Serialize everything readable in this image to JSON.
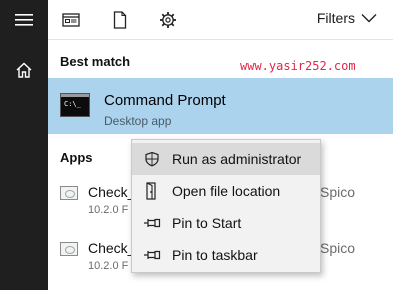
{
  "toolbar": {
    "filters_label": "Filters"
  },
  "best_match": {
    "header": "Best match",
    "item": {
      "title": "Command Prompt",
      "subtitle": "Desktop app",
      "icon_text": "C:\\_"
    }
  },
  "watermark": "www.yasir252.com",
  "apps": {
    "header": "Apps",
    "items": [
      {
        "name": "Check_",
        "version": "10.2.0 F",
        "publisher": "Spico"
      },
      {
        "name": "Check_",
        "version": "10.2.0 F",
        "publisher": "Spico"
      }
    ]
  },
  "context_menu": {
    "items": [
      {
        "label": "Run as administrator",
        "icon": "shield-icon",
        "highlighted": true
      },
      {
        "label": "Open file location",
        "icon": "file-location-icon",
        "highlighted": false
      },
      {
        "label": "Pin to Start",
        "icon": "pin-icon",
        "highlighted": false
      },
      {
        "label": "Pin to taskbar",
        "icon": "pin-icon",
        "highlighted": false
      }
    ]
  },
  "colors": {
    "rail": "#1f1f1f",
    "selection": "#abd3ee",
    "menu_bg": "#f2f2f2",
    "menu_highlight": "#dadada",
    "watermark": "#e0284a"
  }
}
